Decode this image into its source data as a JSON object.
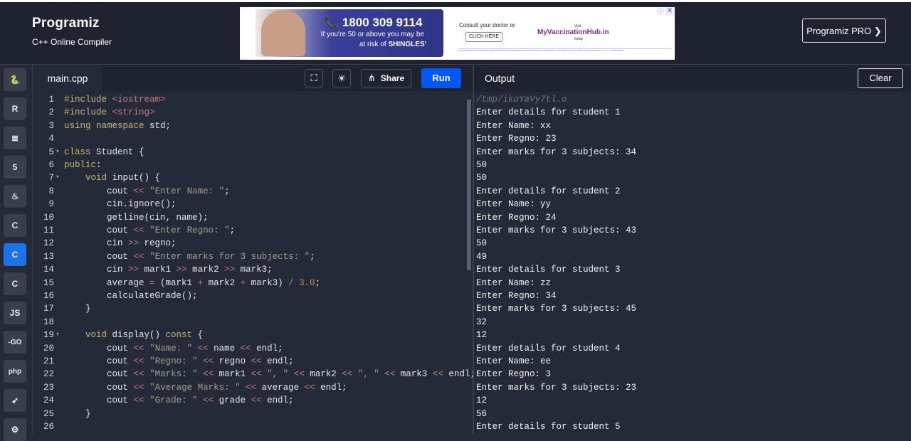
{
  "app": {
    "logo_text": "Programiz",
    "subtitle": "C++ Online Compiler",
    "pro_button": "Programiz PRO ❯"
  },
  "ad": {
    "phone": "📞 1800 309 9114",
    "line1": "If you're 50 or above you may be",
    "line2_prefix": "at risk of ",
    "line2_bold": "SHINGLES'",
    "consult": "Consult your doctor or",
    "click": "CLICK HERE",
    "visit": "Visit",
    "brand_a": "My",
    "brand_b": "VaccinationHub.in",
    "today": "today",
    "fine_print": "A public awareness initiative by GlaxoSmithKline Pharmaceuticals Limited. Information in this material is for awareness only. Please consult your doctor for any medical advice.",
    "close": "✕",
    "info": "ⓘ"
  },
  "sidebar": {
    "items": [
      {
        "name": "python",
        "glyph": "🐍"
      },
      {
        "name": "r",
        "glyph": "R"
      },
      {
        "name": "sql",
        "glyph": "≣"
      },
      {
        "name": "html",
        "glyph": "5"
      },
      {
        "name": "java",
        "glyph": "♨"
      },
      {
        "name": "c",
        "glyph": "C"
      },
      {
        "name": "cpp",
        "glyph": "C"
      },
      {
        "name": "csharp",
        "glyph": "C"
      },
      {
        "name": "javascript",
        "glyph": "JS"
      },
      {
        "name": "go",
        "glyph": "-GO"
      },
      {
        "name": "php",
        "glyph": "php"
      },
      {
        "name": "swift",
        "glyph": "➶"
      },
      {
        "name": "rust",
        "glyph": "⚙"
      }
    ]
  },
  "editor": {
    "file_tab": "main.cpp",
    "share_label": "Share",
    "run_label": "Run",
    "fullscreen_glyph": "⛶",
    "theme_glyph": "☀",
    "share_glyph": "⋔"
  },
  "code_lines": [
    {
      "n": "1",
      "text": "#include <iostream>"
    },
    {
      "n": "2",
      "text": "#include <string>"
    },
    {
      "n": "3",
      "text": "using namespace std;"
    },
    {
      "n": "4",
      "text": ""
    },
    {
      "n": "5",
      "text": "class Student {"
    },
    {
      "n": "6",
      "text": "public:"
    },
    {
      "n": "7",
      "text": "    void input() {"
    },
    {
      "n": "8",
      "text": "        cout << \"Enter Name: \";"
    },
    {
      "n": "9",
      "text": "        cin.ignore();"
    },
    {
      "n": "10",
      "text": "        getline(cin, name);"
    },
    {
      "n": "11",
      "text": "        cout << \"Enter Regno: \";"
    },
    {
      "n": "12",
      "text": "        cin >> regno;"
    },
    {
      "n": "13",
      "text": "        cout << \"Enter marks for 3 subjects: \";"
    },
    {
      "n": "14",
      "text": "        cin >> mark1 >> mark2 >> mark3;"
    },
    {
      "n": "15",
      "text": "        average = (mark1 + mark2 + mark3) / 3.0;"
    },
    {
      "n": "16",
      "text": "        calculateGrade();"
    },
    {
      "n": "17",
      "text": "    }"
    },
    {
      "n": "18",
      "text": ""
    },
    {
      "n": "19",
      "text": "    void display() const {"
    },
    {
      "n": "20",
      "text": "        cout << \"Name: \" << name << endl;"
    },
    {
      "n": "21",
      "text": "        cout << \"Regno: \" << regno << endl;"
    },
    {
      "n": "22",
      "text": "        cout << \"Marks: \" << mark1 << \", \" << mark2 << \", \" << mark3 << endl;"
    },
    {
      "n": "23",
      "text": "        cout << \"Average Marks: \" << average << endl;"
    },
    {
      "n": "24",
      "text": "        cout << \"Grade: \" << grade << endl;"
    },
    {
      "n": "25",
      "text": "    }"
    },
    {
      "n": "26",
      "text": ""
    }
  ],
  "fold_lines": [
    "5",
    "7",
    "19"
  ],
  "output": {
    "title": "Output",
    "clear_label": "Clear",
    "lines": [
      "/tmp/ikoYaVy7tl.o",
      "Enter details for student 1",
      "Enter Name: xx",
      "Enter Regno: 23",
      "Enter marks for 3 subjects: 34",
      "50",
      "50",
      "Enter details for student 2",
      "Enter Name: yy",
      "Enter Regno: 24",
      "Enter marks for 3 subjects: 43",
      "50",
      "49",
      "Enter details for student 3",
      "Enter Name: zz",
      "Enter Regno: 34",
      "Enter marks for 3 subjects: 45",
      "32",
      "12",
      "Enter details for student 4",
      "Enter Name: ee",
      "Enter Regno: 3",
      "Enter marks for 3 subjects: 23",
      "12",
      "56",
      "Enter details for student 5"
    ]
  },
  "colors": {
    "keyword": "#c8b57a",
    "string": "#a29d8c",
    "operator": "#c97a7a",
    "number": "#d68a4a",
    "accent": "#0556f3"
  }
}
